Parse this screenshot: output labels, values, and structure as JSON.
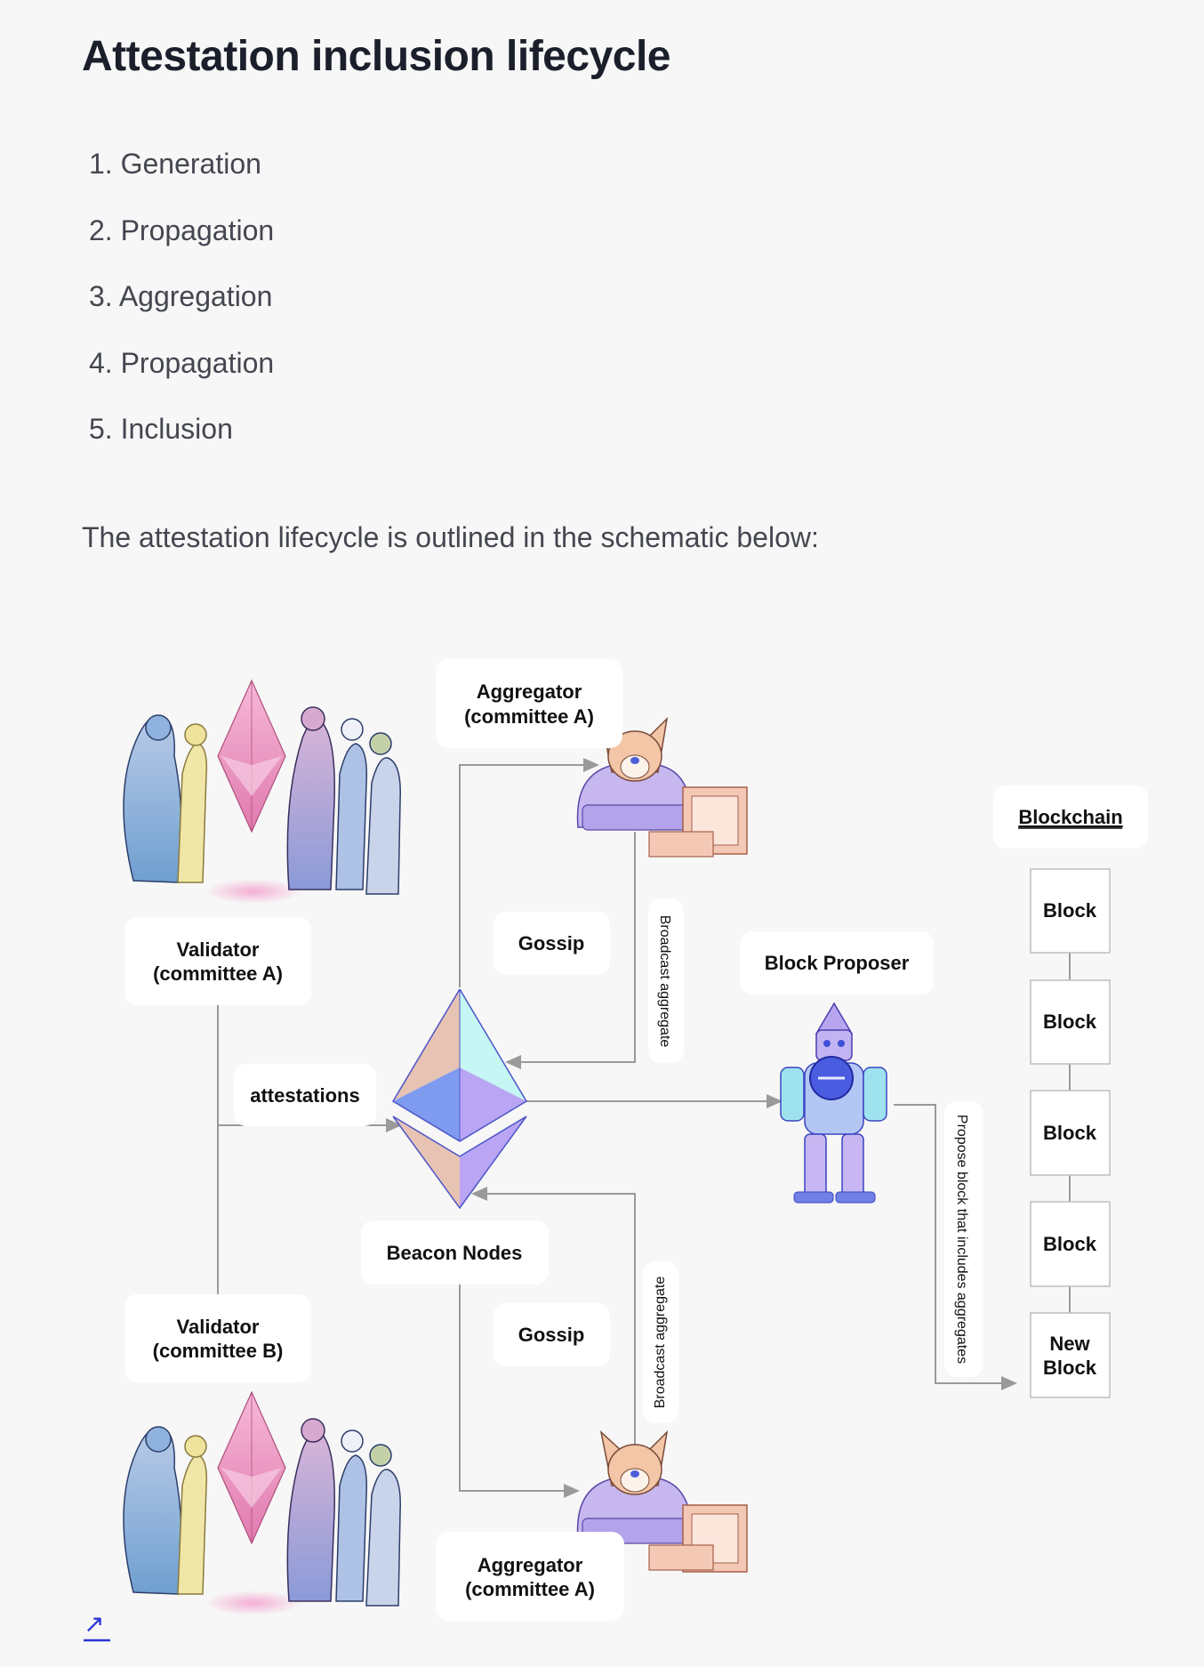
{
  "page": {
    "title": "Attestation inclusion lifecycle",
    "steps": [
      "1. Generation",
      "2. Propagation",
      "3. Aggregation",
      "4. Propagation",
      "5. Inclusion"
    ],
    "intro": "The attestation lifecycle is outlined in the schematic below:"
  },
  "diagram": {
    "aggregator_top": [
      "Aggregator",
      "(committee A)"
    ],
    "aggregator_bottom": [
      "Aggregator",
      "(committee A)"
    ],
    "validator_a": [
      "Validator",
      "(committee A)"
    ],
    "validator_b": [
      "Validator",
      "(committee B)"
    ],
    "gossip_top": "Gossip",
    "gossip_bottom": "Gossip",
    "attestations": "attestations",
    "beacon_nodes": "Beacon Nodes",
    "block_proposer": "Block Proposer",
    "broadcast_aggregate_top": "Broadcast aggregate",
    "broadcast_aggregate_bottom": "Broadcast aggregate",
    "propose_block": "Propose block that includes aggregates",
    "blockchain": "Blockchain",
    "blocks": [
      "Block",
      "Block",
      "Block",
      "Block"
    ],
    "new_block": [
      "New",
      "Block"
    ]
  },
  "colors": {
    "background": "#f7f7f7",
    "link": "#2b35d6",
    "eth_blue": "#7f9bf0",
    "eth_peach": "#e7c3b4",
    "eth_purple": "#b9a5f3",
    "eth_cyan": "#c6f7f4"
  },
  "icons": {
    "external_link": "arrow-up-right-icon"
  },
  "link": {
    "glyph": "↗"
  }
}
